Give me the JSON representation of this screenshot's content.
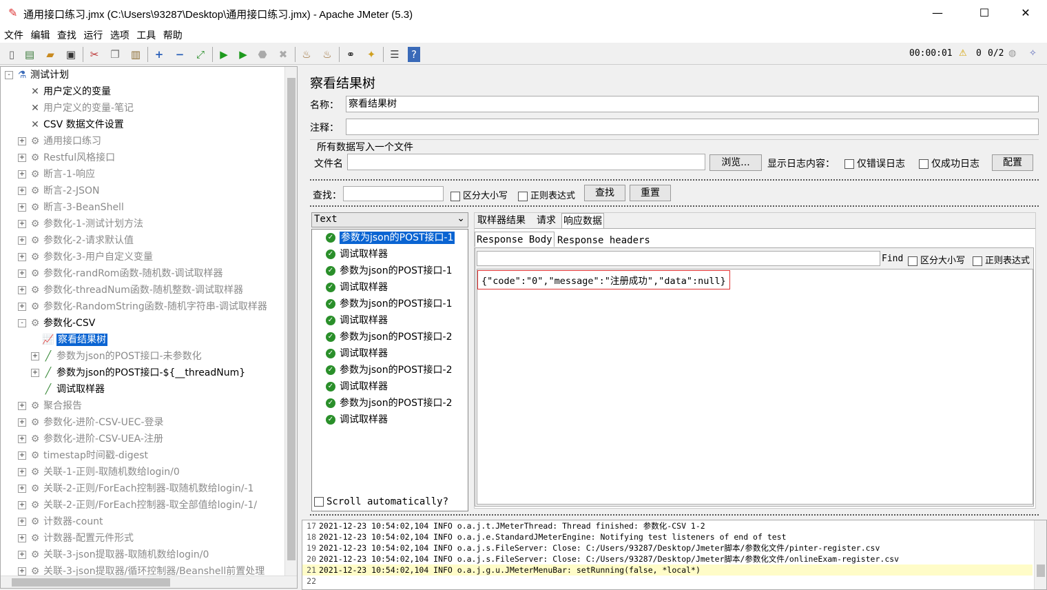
{
  "window": {
    "title": "通用接口练习.jmx (C:\\Users\\93287\\Desktop\\通用接口练习.jmx) - Apache JMeter (5.3)",
    "minimize": "—",
    "maximize": "☐",
    "close": "✕"
  },
  "menu": [
    "文件",
    "编辑",
    "查找",
    "运行",
    "选项",
    "工具",
    "帮助"
  ],
  "toolbar": {
    "timer": "00:00:01",
    "warnings": "0",
    "threads": "0/2"
  },
  "tree": [
    {
      "label": "测试计划",
      "icon": "test-plan-icon",
      "style": "normal",
      "toggle": "-",
      "level": 0
    },
    {
      "label": "用户定义的变量",
      "icon": "wrench-icon",
      "style": "normal",
      "toggle": "",
      "level": 1
    },
    {
      "label": "用户定义的变量-笔记",
      "icon": "wrench-icon",
      "style": "gray",
      "toggle": "",
      "level": 1
    },
    {
      "label": "CSV 数据文件设置",
      "icon": "wrench-icon",
      "style": "normal",
      "toggle": "",
      "level": 1
    },
    {
      "label": "通用接口练习",
      "icon": "gear-icon",
      "style": "gray",
      "toggle": "+",
      "level": 1
    },
    {
      "label": "Restful风格接口",
      "icon": "gear-icon",
      "style": "gray",
      "toggle": "+",
      "level": 1
    },
    {
      "label": "断言-1-响应",
      "icon": "gear-icon",
      "style": "gray",
      "toggle": "+",
      "level": 1
    },
    {
      "label": "断言-2-JSON",
      "icon": "gear-icon",
      "style": "gray",
      "toggle": "+",
      "level": 1
    },
    {
      "label": "断言-3-BeanShell",
      "icon": "gear-icon",
      "style": "gray",
      "toggle": "+",
      "level": 1
    },
    {
      "label": "参数化-1-测试计划方法",
      "icon": "gear-icon",
      "style": "gray",
      "toggle": "+",
      "level": 1
    },
    {
      "label": "参数化-2-请求默认值",
      "icon": "gear-icon",
      "style": "gray",
      "toggle": "+",
      "level": 1
    },
    {
      "label": "参数化-3-用户自定义变量",
      "icon": "gear-icon",
      "style": "gray",
      "toggle": "+",
      "level": 1
    },
    {
      "label": "参数化-randRom函数-随机数-调试取样器",
      "icon": "gear-icon",
      "style": "gray",
      "toggle": "+",
      "level": 1
    },
    {
      "label": "参数化-threadNum函数-随机整数-调试取样器",
      "icon": "gear-icon",
      "style": "gray",
      "toggle": "+",
      "level": 1
    },
    {
      "label": "参数化-RandomString函数-随机字符串-调试取样器",
      "icon": "gear-icon",
      "style": "gray",
      "toggle": "+",
      "level": 1
    },
    {
      "label": "参数化-CSV",
      "icon": "gear-icon",
      "style": "normal",
      "toggle": "-",
      "level": 1
    },
    {
      "label": "察看结果树",
      "icon": "chart-icon",
      "style": "selected",
      "toggle": "",
      "level": 2
    },
    {
      "label": "参数为json的POST接口-未参数化",
      "icon": "pipette-icon",
      "style": "gray",
      "toggle": "+",
      "level": 2
    },
    {
      "label": "参数为json的POST接口-${__threadNum}",
      "icon": "pipette-icon",
      "style": "normal",
      "toggle": "+",
      "level": 2
    },
    {
      "label": "调试取样器",
      "icon": "pipette-icon",
      "style": "normal",
      "toggle": "",
      "level": 2
    },
    {
      "label": "聚合报告",
      "icon": "gear-icon",
      "style": "gray",
      "toggle": "+",
      "level": 1
    },
    {
      "label": "参数化-进阶-CSV-UEC-登录",
      "icon": "gear-icon",
      "style": "gray",
      "toggle": "+",
      "level": 1
    },
    {
      "label": "参数化-进阶-CSV-UEA-注册",
      "icon": "gear-icon",
      "style": "gray",
      "toggle": "+",
      "level": 1
    },
    {
      "label": "timestap时间戳-digest",
      "icon": "gear-icon",
      "style": "gray",
      "toggle": "+",
      "level": 1
    },
    {
      "label": "关联-1-正则-取随机数给login/0",
      "icon": "gear-icon",
      "style": "gray",
      "toggle": "+",
      "level": 1
    },
    {
      "label": "关联-2-正则/ForEach控制器-取随机数给login/-1",
      "icon": "gear-icon",
      "style": "gray",
      "toggle": "+",
      "level": 1
    },
    {
      "label": "关联-2-正则/ForEach控制器-取全部值给login/-1/",
      "icon": "gear-icon",
      "style": "gray",
      "toggle": "+",
      "level": 1
    },
    {
      "label": "计数器-count",
      "icon": "gear-icon",
      "style": "gray",
      "toggle": "+",
      "level": 1
    },
    {
      "label": "计数器-配置元件形式",
      "icon": "gear-icon",
      "style": "gray",
      "toggle": "+",
      "level": 1
    },
    {
      "label": "关联-3-json提取器-取随机数给login/0",
      "icon": "gear-icon",
      "style": "gray",
      "toggle": "+",
      "level": 1
    },
    {
      "label": "关联-3-json提取器/循环控制器/Beanshell前置处理",
      "icon": "gear-icon",
      "style": "gray",
      "toggle": "+",
      "level": 1
    }
  ],
  "panel": {
    "title": "察看结果树",
    "name_label": "名称：",
    "name_value": "察看结果树",
    "comment_label": "注释：",
    "comment_value": "",
    "write_all_label": "所有数据写入一个文件",
    "filename_label": "文件名",
    "filename_value": "",
    "browse_button": "浏览...",
    "log_content_label": "显示日志内容：",
    "errors_only_label": "仅错误日志",
    "success_only_label": "仅成功日志",
    "config_button": "配置",
    "search_label": "查找：",
    "search_value": "",
    "case_sensitive_label": "区分大小写",
    "regex_label": "正则表达式",
    "find_button": "查找",
    "reset_button": "重置"
  },
  "renderer": {
    "selected": "Text",
    "arrow": "⌄"
  },
  "results": [
    {
      "label": "参数为json的POST接口-1",
      "selected": true
    },
    {
      "label": "调试取样器",
      "selected": false
    },
    {
      "label": "参数为json的POST接口-1",
      "selected": false
    },
    {
      "label": "调试取样器",
      "selected": false
    },
    {
      "label": "参数为json的POST接口-1",
      "selected": false
    },
    {
      "label": "调试取样器",
      "selected": false
    },
    {
      "label": "参数为json的POST接口-2",
      "selected": false
    },
    {
      "label": "调试取样器",
      "selected": false
    },
    {
      "label": "参数为json的POST接口-2",
      "selected": false
    },
    {
      "label": "调试取样器",
      "selected": false
    },
    {
      "label": "参数为json的POST接口-2",
      "selected": false
    },
    {
      "label": "调试取样器",
      "selected": false
    }
  ],
  "scroll_auto_label": "Scroll automatically?",
  "result_tabs": {
    "sampler": "取样器结果",
    "request": "请求",
    "response": "响应数据"
  },
  "response_tabs": {
    "body": "Response Body",
    "headers": "Response headers"
  },
  "find_bar": {
    "find_label": "Find",
    "case_label": "区分大小写",
    "regex_label": "正则表达式",
    "value": ""
  },
  "response_body": "{\"code\":\"0\",\"message\":\"注册成功\",\"data\":null}",
  "log": [
    {
      "n": "17",
      "text": "2021-12-23 10:54:02,104 INFO o.a.j.t.JMeterThread: Thread finished: 参数化-CSV 1-2"
    },
    {
      "n": "18",
      "text": "2021-12-23 10:54:02,104 INFO o.a.j.e.StandardJMeterEngine: Notifying test listeners of end of test"
    },
    {
      "n": "19",
      "text": "2021-12-23 10:54:02,104 INFO o.a.j.s.FileServer: Close: C:/Users/93287/Desktop/Jmeter脚本/参数化文件/pinter-register.csv"
    },
    {
      "n": "20",
      "text": "2021-12-23 10:54:02,104 INFO o.a.j.s.FileServer: Close: C:/Users/93287/Desktop/Jmeter脚本/参数化文件/onlineExam-register.csv"
    },
    {
      "n": "21",
      "text": "2021-12-23 10:54:02,104 INFO o.a.j.g.u.JMeterMenuBar: setRunning(false, *local*)"
    },
    {
      "n": "22",
      "text": ""
    }
  ],
  "colors": {
    "selection": "#0a64d2",
    "highlight_box": "#e03030",
    "log_current_line": "#fffcc8"
  }
}
